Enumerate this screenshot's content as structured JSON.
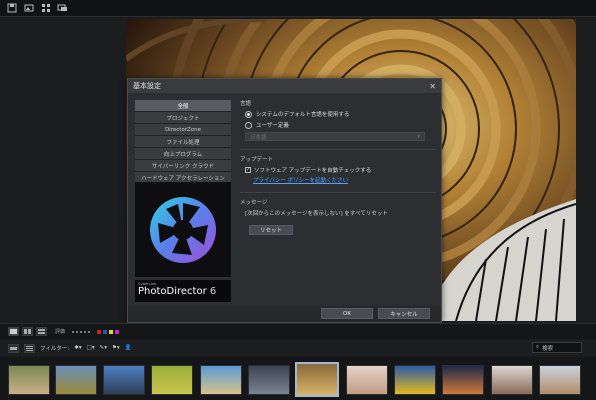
{
  "dialog": {
    "title": "基本設定",
    "nav_items": [
      {
        "label": "全般",
        "active": true
      },
      {
        "label": "プロジェクト",
        "active": false
      },
      {
        "label": "DirectorZone",
        "active": false
      },
      {
        "label": "ファイル処理",
        "active": false
      },
      {
        "label": "向上プログラム",
        "active": false
      },
      {
        "label": "サイバーリンク クラウド",
        "active": false
      },
      {
        "label": "ハードウェア アクセラレーション",
        "active": false
      }
    ],
    "brand_small": "CyberLink",
    "brand_name": "PhotoDirector",
    "brand_version": "6",
    "language_label": "言語",
    "language_option1": "システムのデフォルト言語を使用する",
    "language_option2": "ユーザー定義",
    "language_select": "日本語",
    "update_label": "アップデート",
    "update_check": "ソフトウェア アップデートを自動チェックする",
    "privacy_link": "プライバシー ポリシーを起動ください",
    "message_label": "メッセージ",
    "message_desc": "[次回からこのメッセージを表示しない] をすべてリセット",
    "reset_button": "リセット",
    "ok_button": "OK",
    "cancel_button": "キャンセル"
  },
  "bottom": {
    "flag_label": "評価",
    "filter_label": "フィルター:",
    "search_placeholder": "検索",
    "swatch_colors": [
      "#cc2222",
      "#2255cc",
      "#dddd22",
      "#cc22cc"
    ]
  },
  "thumbnails": [
    {
      "name": "sheep",
      "colors": [
        "#7c8a52",
        "#c9b089"
      ],
      "selected": false
    },
    {
      "name": "landscape",
      "colors": [
        "#6b8fb8",
        "#9a8a3a"
      ],
      "selected": false
    },
    {
      "name": "lake",
      "colors": [
        "#4d7fc0",
        "#2f3f56"
      ],
      "selected": false
    },
    {
      "name": "flowers",
      "colors": [
        "#9ab03a",
        "#c9c54e"
      ],
      "selected": false
    },
    {
      "name": "beach",
      "colors": [
        "#5a9bd6",
        "#d7c28a"
      ],
      "selected": false
    },
    {
      "name": "storm",
      "colors": [
        "#3c4552",
        "#7a8391"
      ],
      "selected": false
    },
    {
      "name": "spiral",
      "colors": [
        "#8a6a3a",
        "#d8b36a"
      ],
      "selected": true
    },
    {
      "name": "portrait",
      "colors": [
        "#e2d4c8",
        "#c49a83"
      ],
      "selected": false
    },
    {
      "name": "sunflower",
      "colors": [
        "#2b5ba8",
        "#e6b81e"
      ],
      "selected": false
    },
    {
      "name": "sunset",
      "colors": [
        "#1f2a4a",
        "#d07a3a"
      ],
      "selected": false
    },
    {
      "name": "woman",
      "colors": [
        "#dcd6d2",
        "#8a6a58"
      ],
      "selected": false
    },
    {
      "name": "girl",
      "colors": [
        "#c8d2dc",
        "#b48c6a"
      ],
      "selected": false
    }
  ]
}
